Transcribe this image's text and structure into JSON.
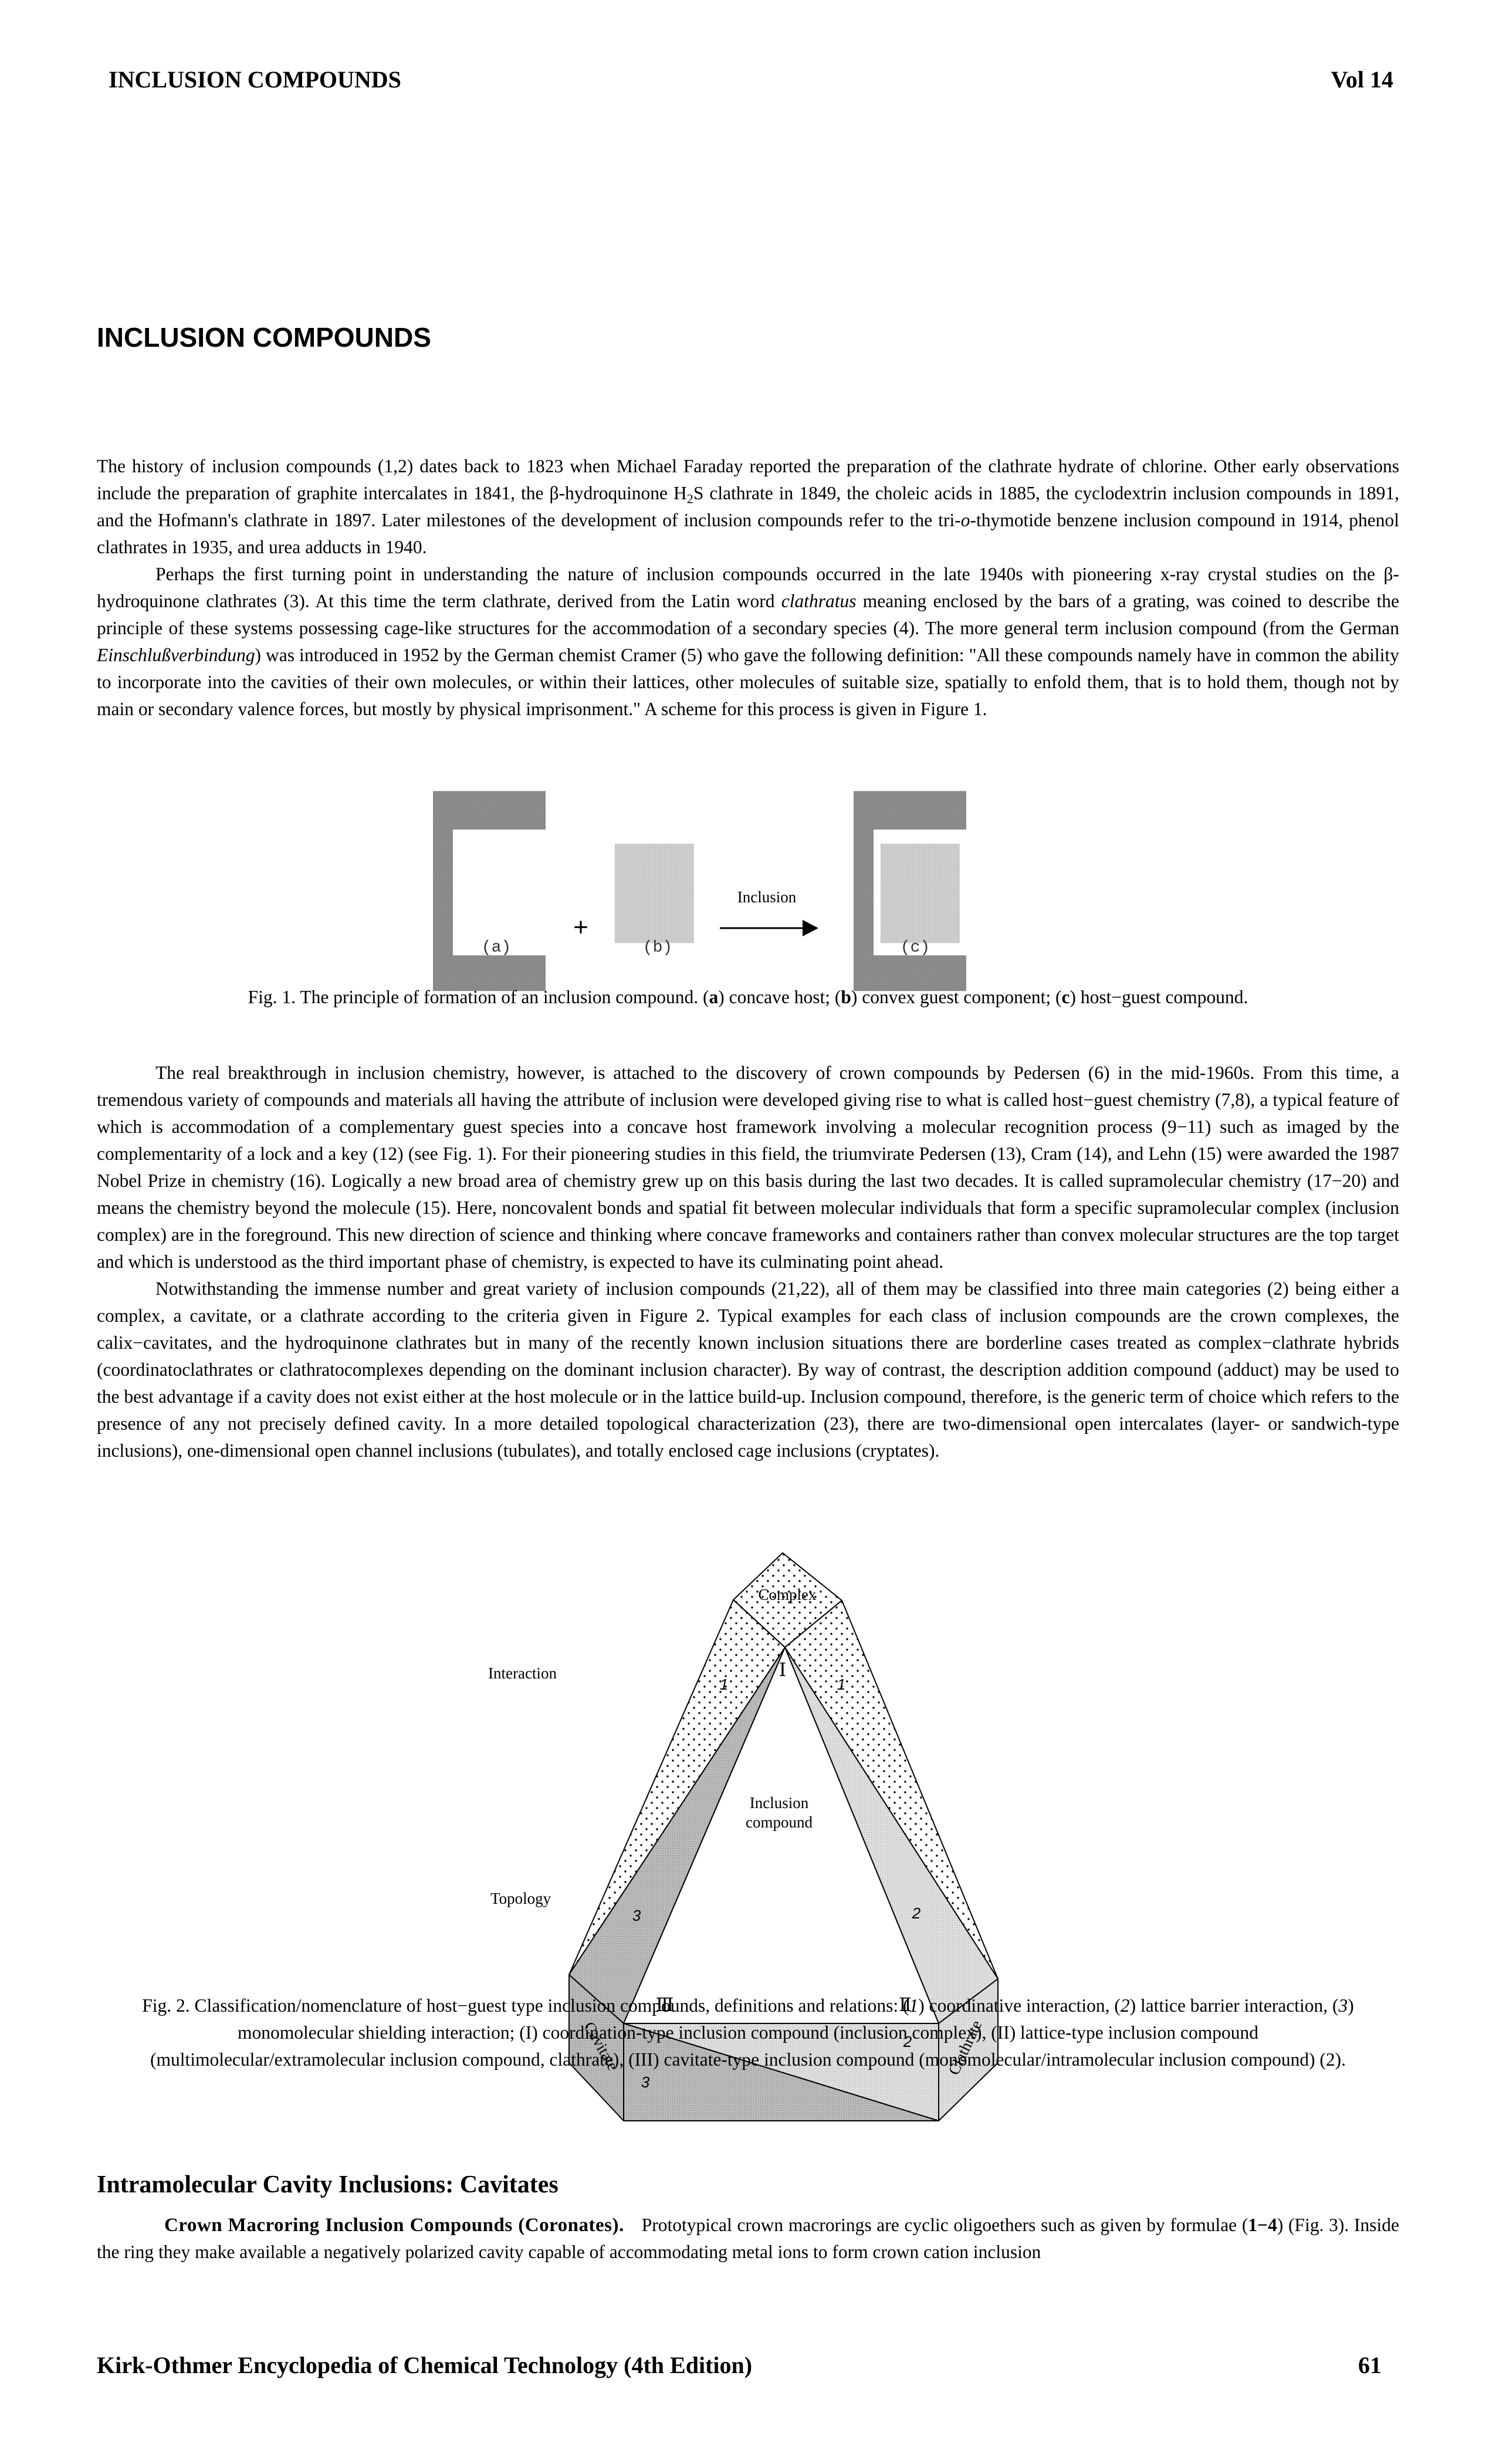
{
  "header": {
    "running_title": "INCLUSION COMPOUNDS",
    "volume": "Vol 14"
  },
  "article": {
    "title": "INCLUSION COMPOUNDS",
    "paragraphs": [
      {
        "indent": false,
        "parts": [
          {
            "t": "The history of inclusion compounds (1,2) dates back to 1823 when Michael Faraday reported the preparation of the clathrate hydrate of chlorine. Other early observations include the preparation of graphite intercalates in 1841, the β-hydroquinone H"
          },
          {
            "t": "2",
            "sub": true
          },
          {
            "t": "S clathrate in 1849, the choleic acids in 1885, the cyclodextrin inclusion compounds in 1891, and the Hofmann's clathrate in 1897. Later milestones of the development of inclusion compounds refer to the tri-"
          },
          {
            "t": "o",
            "i": true
          },
          {
            "t": "-thymotide benzene inclusion compound in 1914, phenol clathrates in 1935, and urea adducts in 1940."
          }
        ]
      },
      {
        "indent": true,
        "parts": [
          {
            "t": "Perhaps the first turning point in understanding the nature of inclusion compounds occurred in the late 1940s with pioneering x-ray crystal studies on the β-hydroquinone clathrates (3). At this time the term clathrate, derived from the Latin word "
          },
          {
            "t": "clathratus",
            "i": true
          },
          {
            "t": " meaning enclosed by the bars of a grating, was coined to describe the principle of these systems possessing cage-like structures for the accommodation of a secondary species (4). The more general term inclusion compound (from the German "
          },
          {
            "t": "Einschlußverbindung",
            "i": true
          },
          {
            "t": ") was introduced in 1952 by the German chemist Cramer (5) who gave the following definition: \"All these compounds namely have in common the ability to incorporate into the cavities of their own molecules, or within their lattices, other molecules of suitable size, spatially to enfold them, that is to hold them, though not by main or secondary valence forces, but mostly by physical imprisonment.\" A scheme for this process is given in Figure 1."
          }
        ]
      }
    ],
    "paragraphs2": [
      {
        "indent": true,
        "parts": [
          {
            "t": "The real breakthrough in inclusion chemistry, however, is attached to the discovery of crown compounds by Pedersen (6) in the mid-1960s. From this time, a tremendous variety of compounds and materials all having the attribute of inclusion were developed giving rise to what is called host−guest chemistry (7,8), a typical feature of which is accommodation of a complementary guest species into a concave host framework involving a molecular recognition process (9−11) such as imaged by the complementarity of a lock and a key (12) (see Fig. 1). For their pioneering studies in this field, the triumvirate Pedersen (13), Cram (14), and Lehn (15) were awarded the 1987 Nobel Prize in chemistry (16). Logically a new broad area of chemistry grew up on this basis during the last two decades. It is called supramolecular chemistry (17−20) and means the chemistry beyond the molecule (15). Here, noncovalent bonds and spatial fit between molecular individuals that form a specific supramolecular complex (inclusion complex) are in the foreground. This new direction of science and thinking where concave frameworks and containers rather than convex molecular structures are the top target and which is understood as the third important phase of chemistry, is expected to have its culminating point ahead."
          }
        ]
      },
      {
        "indent": true,
        "parts": [
          {
            "t": "Notwithstanding the immense number and great variety of inclusion compounds (21,22), all of them may be classified into three main categories (2) being either a complex, a cavitate, or a clathrate according to the criteria given in Figure 2. Typical examples for each class of inclusion compounds are the crown complexes, the calix−cavitates, and the hydroquinone clathrates but in many of the recently known inclusion situations there are borderline cases treated as complex−clathrate hybrids (coordinatoclathrates or clathratocomplexes depending on the dominant inclusion character). By way of contrast, the description addition compound (adduct) may be used to the best advantage if a cavity does not exist either at the host molecule or in the lattice build-up. Inclusion compound, therefore, is the generic term of choice which refers to the presence of any not precisely defined cavity. In a more detailed topological characterization (23), there are two-dimensional open intercalates (layer- or sandwich-type inclusions), one-dimensional open channel inclusions (tubulates), and totally enclosed cage inclusions (cryptates)."
          }
        ]
      }
    ]
  },
  "figure1": {
    "arrow_label": "Inclusion",
    "plus": "+",
    "panel_labels": [
      "(a)",
      "(b)",
      "(c)"
    ],
    "caption_parts": [
      {
        "t": "Fig. 1. The principle of formation of an inclusion compound. ("
      },
      {
        "t": "a",
        "b": true
      },
      {
        "t": ") concave host; ("
      },
      {
        "t": "b",
        "b": true
      },
      {
        "t": ") convex guest component; ("
      },
      {
        "t": "c",
        "b": true
      },
      {
        "t": ") host−guest compound."
      }
    ],
    "colors": {
      "host": "#8a8a8a",
      "guest": "#c4c4c4"
    }
  },
  "figure2": {
    "axis_labels": {
      "interaction": "Interaction",
      "topology": "Topology"
    },
    "vertex_labels": {
      "complex": "Complex",
      "cavitate": "Cavitate",
      "clathrate": "Clathrate"
    },
    "center_label_lines": [
      "Inclusion",
      "compound"
    ],
    "roman": {
      "I": "Ⅰ",
      "II": "Ⅱ",
      "III": "Ⅲ"
    },
    "band_numbers": {
      "left_1": "1",
      "right_1": "1",
      "left_3": "3",
      "right_2": "2",
      "base_2": "2",
      "base_3": "3"
    },
    "caption_parts": [
      {
        "t": "Fig. 2. Classification/nomenclature of host−guest type inclusion compounds, definitions and relations: ("
      },
      {
        "t": "1",
        "i": true
      },
      {
        "t": ") coordinative interaction, ("
      },
      {
        "t": "2",
        "i": true
      },
      {
        "t": ") lattice barrier interaction, ("
      },
      {
        "t": "3",
        "i": true
      },
      {
        "t": ") monomolecular shielding interaction; (I) coordination-type inclusion compound (inclusion complex), (II) lattice-type inclusion compound (multimolecular/extramolecular inclusion compound, clathrate), (III) cavitate-type inclusion compound (monomolecular/intramolecular inclusion compound) (2)."
      }
    ]
  },
  "section": {
    "heading": "Intramolecular Cavity Inclusions: Cavitates",
    "run_in": "Crown Macroring Inclusion Compounds (Coronates).",
    "parts": [
      {
        "t": "Prototypical crown macrorings are cyclic oligoethers such as given by formulae ("
      },
      {
        "t": "1−4",
        "b": true
      },
      {
        "t": ") (Fig. 3). Inside the ring they make available a negatively polarized cavity capable of accommodating metal ions to form crown cation inclusion"
      }
    ]
  },
  "footer": {
    "publication": "Kirk-Othmer Encyclopedia of Chemical Technology (4th Edition)",
    "page_number": "61"
  }
}
